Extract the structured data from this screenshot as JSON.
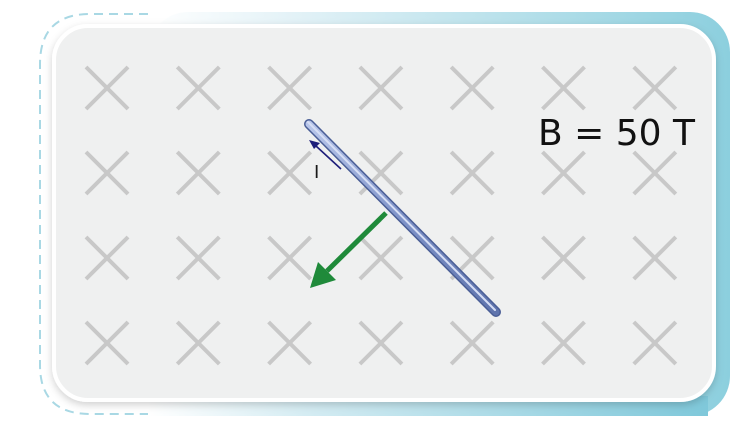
{
  "field": {
    "label": "B = 50 T",
    "direction": "into-page",
    "symbol_icon": "cross-icon",
    "rows": 4,
    "columns": 7
  },
  "current": {
    "label": "I"
  },
  "colors": {
    "frame_accent": "#8ccfde",
    "panel_fill": "#eff0f0",
    "cross": "#c8c8c8",
    "rod": "#8a9dd0",
    "current_arrow": "#1d1d7a",
    "force_arrow": "#1f8a3a"
  }
}
